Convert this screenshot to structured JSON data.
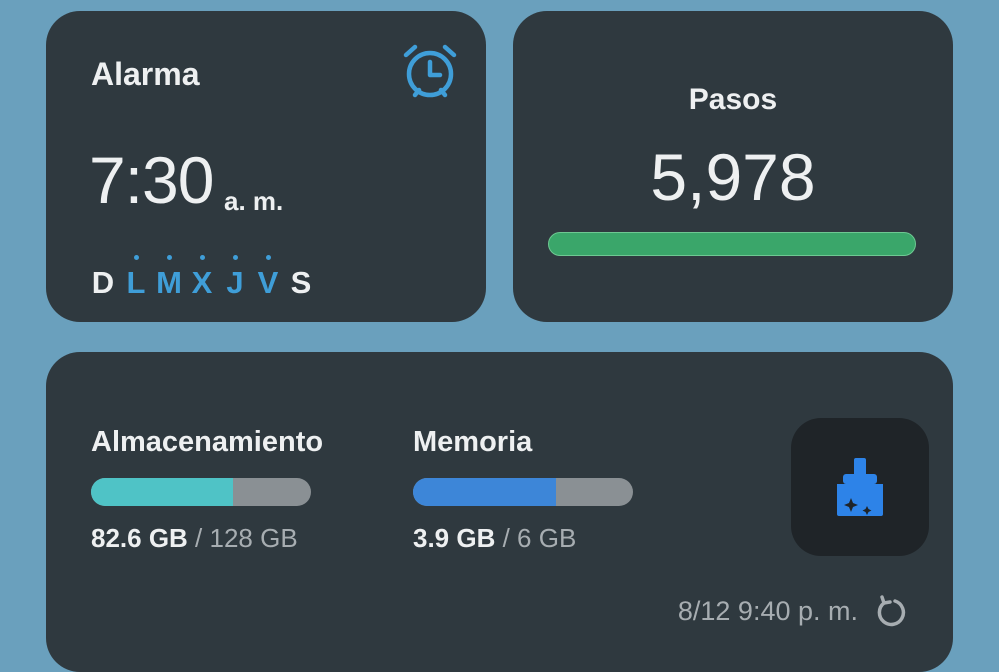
{
  "alarm": {
    "title": "Alarma",
    "time": "7:30",
    "ampm": "a. m.",
    "icon": "alarm-clock-icon",
    "days": [
      {
        "label": "D",
        "active": false
      },
      {
        "label": "L",
        "active": true
      },
      {
        "label": "M",
        "active": true
      },
      {
        "label": "X",
        "active": true
      },
      {
        "label": "J",
        "active": true
      },
      {
        "label": "V",
        "active": true
      },
      {
        "label": "S",
        "active": false
      }
    ],
    "accent_color": "#3f9ed8"
  },
  "steps": {
    "title": "Pasos",
    "value": "5,978",
    "bar_color": "#3aa66a",
    "progress_fraction": 1.0
  },
  "device": {
    "storage": {
      "label": "Almacenamiento",
      "used": "82.6 GB",
      "sep": " / ",
      "total": "128 GB",
      "fraction": 0.645,
      "color": "#4fc3c6"
    },
    "memory": {
      "label": "Memoria",
      "used": "3.9 GB",
      "sep": " / ",
      "total": "6 GB",
      "fraction": 0.65,
      "color": "#3d86d8"
    },
    "clean_icon": "broom-sparkle-icon",
    "timestamp": "8/12 9:40 p. m.",
    "refresh_icon": "refresh-icon"
  }
}
